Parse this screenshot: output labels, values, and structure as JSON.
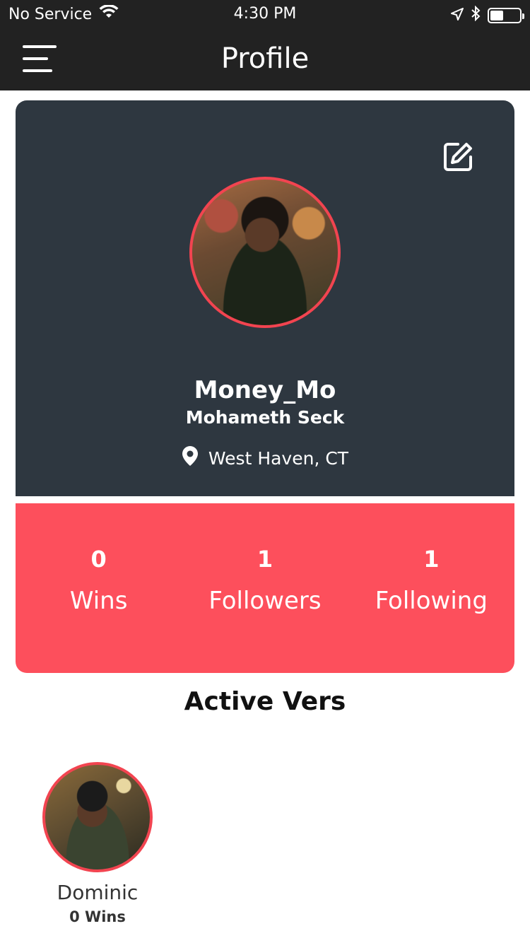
{
  "status_bar": {
    "carrier": "No Service",
    "time": "4:30 PM",
    "wifi_icon": "wifi-icon",
    "location_icon": "location-arrow-icon",
    "bluetooth_icon": "bluetooth-icon",
    "battery_icon": "battery-icon"
  },
  "header": {
    "title": "Profile",
    "menu_icon": "hamburger-menu-icon"
  },
  "profile": {
    "username": "Money_Mo",
    "full_name": "Mohameth Seck",
    "location": "West Haven, CT",
    "edit_icon": "edit-icon",
    "pin_icon": "map-pin-icon"
  },
  "stats": [
    {
      "value": "0",
      "label": "Wins"
    },
    {
      "value": "1",
      "label": "Followers"
    },
    {
      "value": "1",
      "label": "Following"
    }
  ],
  "active_vers": {
    "title": "Active Vers",
    "items": [
      {
        "name": "Dominic",
        "wins": "0 Wins"
      }
    ]
  },
  "colors": {
    "header_bg": "#222222",
    "card_bg": "#2e3740",
    "accent": "#fd4f5c",
    "avatar_ring": "#f24450"
  }
}
